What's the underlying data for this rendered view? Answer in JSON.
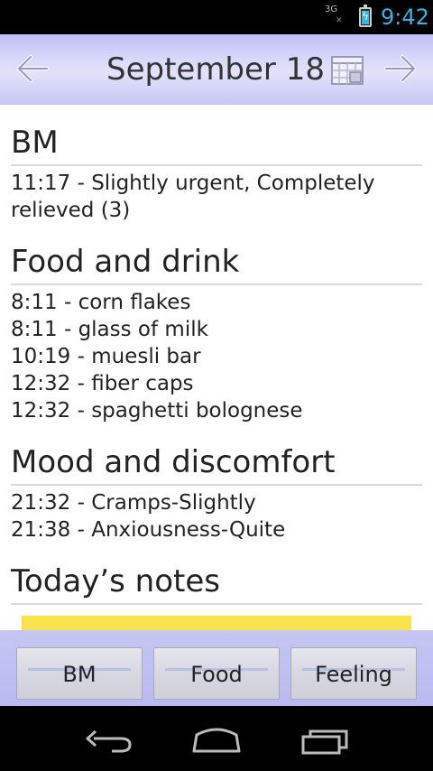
{
  "status_bar": {
    "network": "3G",
    "time": "9:42"
  },
  "header": {
    "date": "September 18",
    "icons": {
      "prev": "arrow-left-icon",
      "next": "arrow-right-icon",
      "calendar": "calendar-icon"
    }
  },
  "sections": [
    {
      "title": "BM",
      "entries": [
        "11:17 - Slightly urgent, Completely relieved (3)"
      ]
    },
    {
      "title": "Food and drink",
      "entries": [
        "8:11 - corn flakes",
        "8:11 - glass of milk",
        "10:19 - muesli bar",
        "12:32 - fiber caps",
        "12:32 - spaghetti bolognese"
      ]
    },
    {
      "title": "Mood and discomfort",
      "entries": [
        "21:32 - Cramps-Slightly",
        "21:38 - Anxiousness-Quite"
      ]
    },
    {
      "title": "Today’s notes",
      "entries": []
    }
  ],
  "buttons": {
    "bm": "BM",
    "food": "Food",
    "feeling": "Feeling"
  },
  "colors": {
    "accent": "#33b5e5",
    "header": "#d8d8fa",
    "notes": "#f8e34a"
  }
}
